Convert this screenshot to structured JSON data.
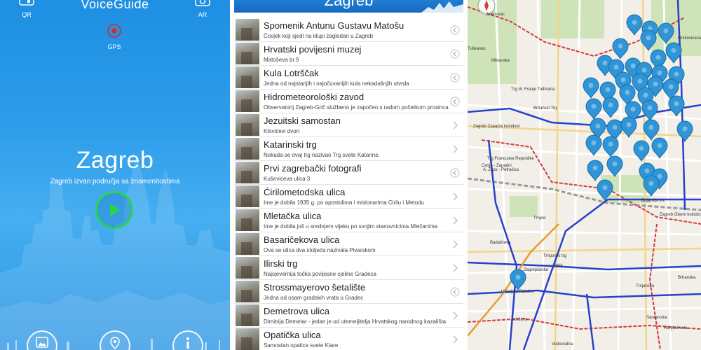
{
  "home": {
    "app_name": "VoiceGuide",
    "qr_label": "QR",
    "ar_label": "AR",
    "gps_label": "GPS",
    "city_name": "Zagreb",
    "city_subtitle": "Zagreb izvan područja sa znamenitostima",
    "icons": {
      "qr": "qr-icon",
      "ar": "camera-icon",
      "gps": "gps-target-icon",
      "play": "play-icon",
      "gallery": "gallery-icon",
      "map": "map-pin-icon",
      "info": "info-icon"
    },
    "colors": {
      "background": "#2c9cea",
      "play_accent": "#2bd34a",
      "gps_accent": "#e52222"
    }
  },
  "list": {
    "header_title": "Zagreb",
    "items": [
      {
        "title": "Spomenik Antunu Gustavu Matošu",
        "subtitle": "Čovjek koji sjedi na klupi zagledan u Zagreb",
        "action": "audio"
      },
      {
        "title": "Hrvatski povijesni muzej",
        "subtitle": "Matoševa br.9",
        "action": "audio"
      },
      {
        "title": "Kula Lotrščak",
        "subtitle": "Jedna od najstarijih i najočuvanijih kula nekadašnjih utvrda",
        "action": "audio"
      },
      {
        "title": "Hidrometeorološki zavod",
        "subtitle": "Observatorij Zagreb-Grič službeno je započeo s radom početkom prosinca 1861",
        "action": "audio"
      },
      {
        "title": "Jezuitski samostan",
        "subtitle": "Klovićevi dvori",
        "action": "chevron"
      },
      {
        "title": "Katarinski trg",
        "subtitle": "Nekada se ovaj trg nazivao Trg svete Katarine.",
        "action": "chevron"
      },
      {
        "title": "Prvi zagrebački fotografi",
        "subtitle": "Kuševićeva ulica 3",
        "action": "audio"
      },
      {
        "title": "Ćirilometodska ulica",
        "subtitle": "Ime je dobila 1935 g. po apostolima i misionarima Ćirilu i Metodu",
        "action": "chevron"
      },
      {
        "title": "Mletačka ulica",
        "subtitle": "Ime je dobila još u srednjem vijeku po svojim stanovnicima Mlečanima",
        "action": "chevron"
      },
      {
        "title": "Basaričekova ulica",
        "subtitle": "Ova se ulica dva stoljeća nazivala Pivarskom",
        "action": "chevron"
      },
      {
        "title": "Ilirski trg",
        "subtitle": "Najsjevernija točka povijesne cjeline Gradeca",
        "action": "chevron"
      },
      {
        "title": "Strossmayerovo šetalište",
        "subtitle": "Jedna od osam gradskih vrata u Gradec",
        "action": "audio"
      },
      {
        "title": "Demetrova ulica",
        "subtitle": "Dimitrija Demetar - jedan je od utemeljitelja Hrvatskog narodnog kazališta",
        "action": "chevron"
      },
      {
        "title": "Opatička ulica",
        "subtitle": "Samostan opatica svete Klare",
        "action": "chevron"
      }
    ],
    "colors": {
      "header": "#1e7fd4"
    }
  },
  "map": {
    "labels": [
      "Jelenovac",
      "Grškovićeva",
      "Tuškanac",
      "Mlinarska",
      "Trg dr. Franje Tuđmana",
      "Britanski Trg",
      "Zagreb Zapadni kolodvor",
      "Trg Francuske Republike",
      "A. Žaps - Petračica",
      "Cesta - Zapadni",
      "Botanički vrt",
      "Zagreb Glavni kolodvor",
      "Trnjski",
      "Badalićeva",
      "Vrbik",
      "Zagrepčanka",
      "Trnjanski trg",
      "Učiteljski Fakultet",
      "Trnjanska",
      "Sarajevska",
      "Runjaninova",
      "Jukićeva",
      "Vodovodna",
      "Brhanska"
    ],
    "icons": {
      "marker": "map-marker-icon",
      "compass": "compass-icon"
    },
    "colors": {
      "marker": "#2f95d6",
      "tram_line": "#2741c9",
      "bus_line": "#d43a3a",
      "rail_line": "#e79a2e"
    }
  }
}
